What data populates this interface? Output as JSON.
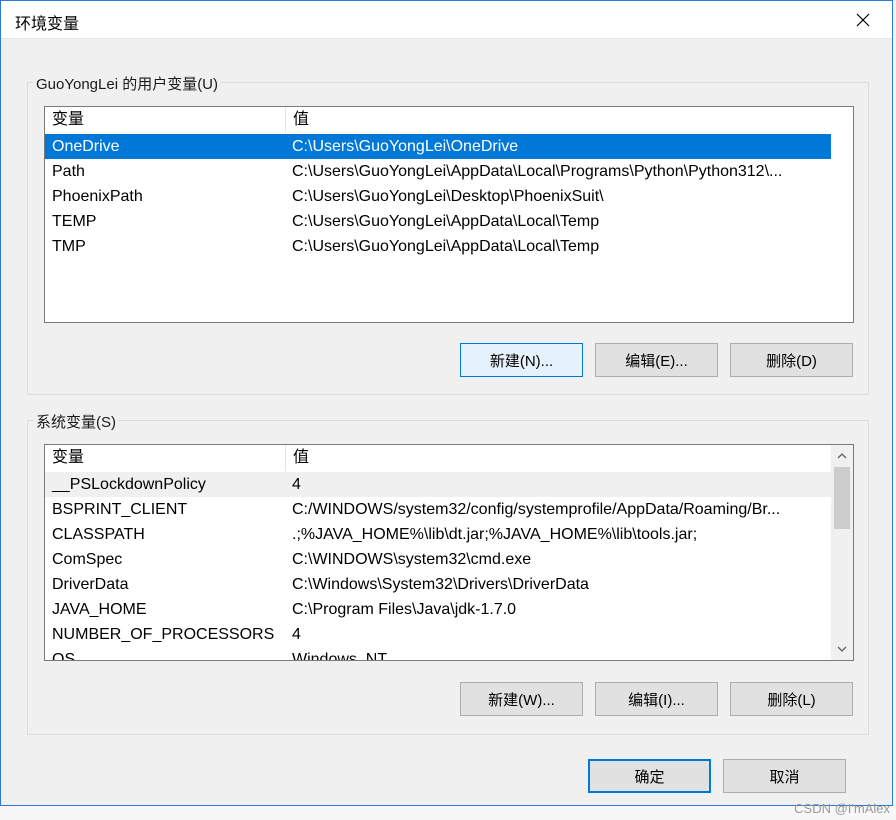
{
  "window": {
    "title": "环境变量"
  },
  "user_vars": {
    "label": "GuoYongLei 的用户变量(U)",
    "columns": [
      "变量",
      "值"
    ],
    "rows": [
      {
        "name": "OneDrive",
        "value": "C:\\Users\\GuoYongLei\\OneDrive",
        "selected": true
      },
      {
        "name": "Path",
        "value": "C:\\Users\\GuoYongLei\\AppData\\Local\\Programs\\Python\\Python312\\..."
      },
      {
        "name": "PhoenixPath",
        "value": "C:\\Users\\GuoYongLei\\Desktop\\PhoenixSuit\\"
      },
      {
        "name": "TEMP",
        "value": "C:\\Users\\GuoYongLei\\AppData\\Local\\Temp"
      },
      {
        "name": "TMP",
        "value": "C:\\Users\\GuoYongLei\\AppData\\Local\\Temp"
      }
    ],
    "buttons": {
      "new": "新建(N)...",
      "edit": "编辑(E)...",
      "delete": "删除(D)"
    }
  },
  "system_vars": {
    "label": "系统变量(S)",
    "columns": [
      "变量",
      "值"
    ],
    "rows": [
      {
        "name": "__PSLockdownPolicy",
        "value": "4"
      },
      {
        "name": "BSPRINT_CLIENT",
        "value": "C:/WINDOWS/system32/config/systemprofile/AppData/Roaming/Br..."
      },
      {
        "name": "CLASSPATH",
        "value": ".;%JAVA_HOME%\\lib\\dt.jar;%JAVA_HOME%\\lib\\tools.jar;"
      },
      {
        "name": "ComSpec",
        "value": "C:\\WINDOWS\\system32\\cmd.exe"
      },
      {
        "name": "DriverData",
        "value": "C:\\Windows\\System32\\Drivers\\DriverData"
      },
      {
        "name": "JAVA_HOME",
        "value": "C:\\Program Files\\Java\\jdk-1.7.0"
      },
      {
        "name": "NUMBER_OF_PROCESSORS",
        "value": "4"
      },
      {
        "name": "OS",
        "value": "Windows_NT"
      }
    ],
    "buttons": {
      "new": "新建(W)...",
      "edit": "编辑(I)...",
      "delete": "删除(L)"
    }
  },
  "footer": {
    "ok": "确定",
    "cancel": "取消"
  },
  "watermark": "CSDN @I'mAlex",
  "colors": {
    "accent": "#0078d7",
    "selection": "#0078d7"
  }
}
